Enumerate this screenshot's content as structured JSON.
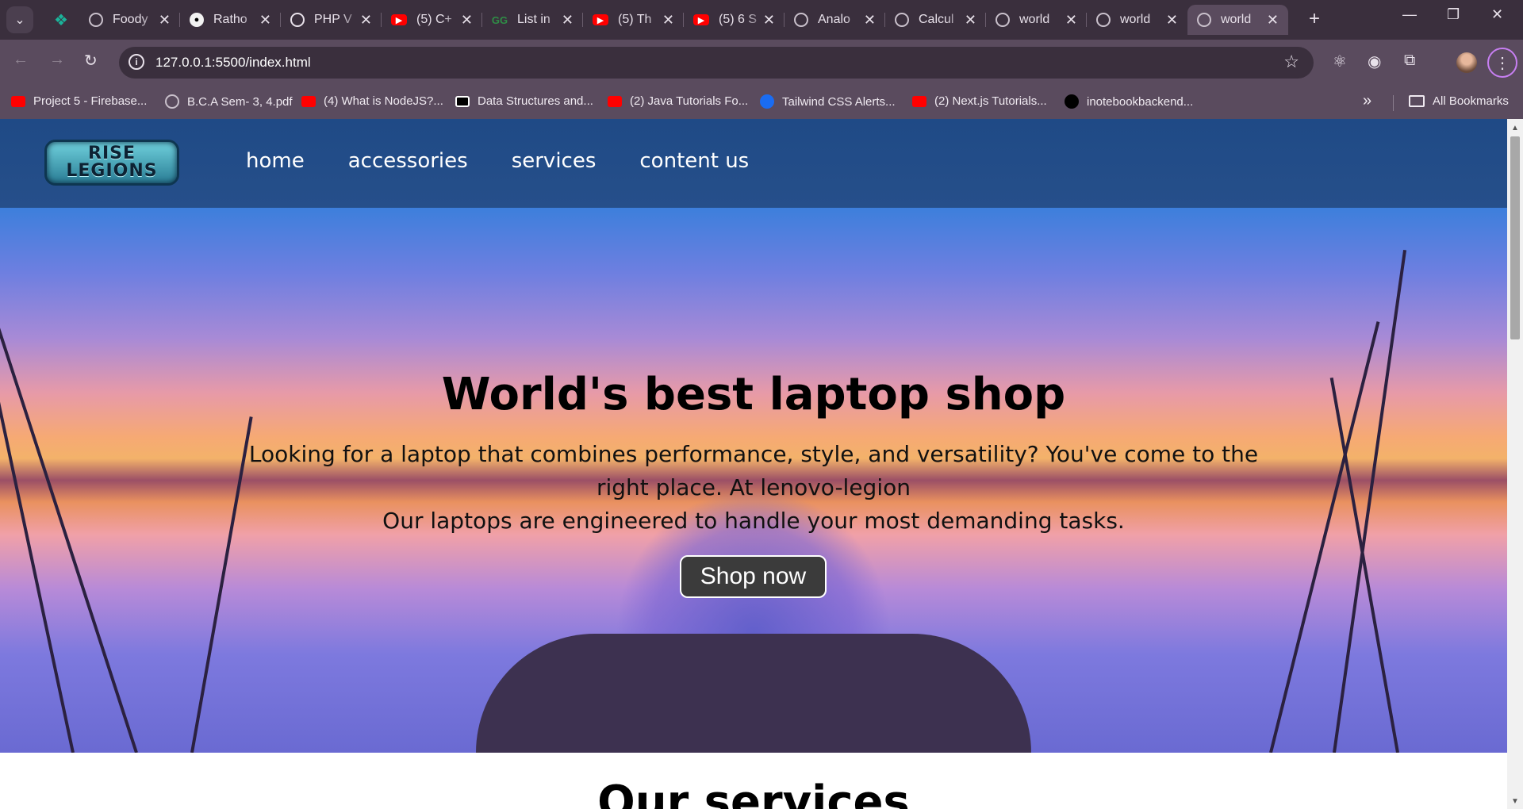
{
  "browser": {
    "tabs": [
      {
        "title": "",
        "icon": "foody-icon"
      },
      {
        "title": "Foody",
        "icon": "globe-icon"
      },
      {
        "title": "Ratho",
        "icon": "github-icon"
      },
      {
        "title": "PHP V",
        "icon": "chatgpt-icon"
      },
      {
        "title": "(5) C+",
        "icon": "youtube-icon"
      },
      {
        "title": "List in",
        "icon": "gfg-icon"
      },
      {
        "title": "(5) Th",
        "icon": "youtube-icon"
      },
      {
        "title": "(5) 6 S",
        "icon": "youtube-icon"
      },
      {
        "title": "Analo",
        "icon": "globe-icon"
      },
      {
        "title": "Calcul",
        "icon": "globe-icon"
      },
      {
        "title": "world",
        "icon": "globe-icon"
      },
      {
        "title": "world",
        "icon": "globe-icon"
      },
      {
        "title": "world",
        "icon": "globe-icon",
        "active": true
      }
    ],
    "url": "127.0.0.1:5500/index.html",
    "bookmarks": [
      {
        "label": "Project 5 - Firebase...",
        "icon": "youtube-icon"
      },
      {
        "label": "B.C.A Sem- 3, 4.pdf",
        "icon": "globe-icon"
      },
      {
        "label": "(4) What is NodeJS?...",
        "icon": "youtube-icon"
      },
      {
        "label": "Data Structures and...",
        "icon": "dsa-icon"
      },
      {
        "label": "(2) Java Tutorials Fo...",
        "icon": "youtube-icon"
      },
      {
        "label": "Tailwind CSS Alerts...",
        "icon": "tailwind-icon"
      },
      {
        "label": "(2) Next.js Tutorials...",
        "icon": "youtube-icon"
      },
      {
        "label": "inotebookbackend...",
        "icon": "triangle-icon"
      }
    ],
    "all_bookmarks": "All Bookmarks"
  },
  "site": {
    "logo_line1": "RISE",
    "logo_line2": "LEGIONS",
    "nav": [
      "home",
      "accessories",
      "services",
      "content us"
    ],
    "hero_title": "World's best laptop shop",
    "hero_text_1": "Looking for a laptop that combines performance, style, and versatility? You've come to the right place. At lenovo-legion",
    "hero_text_2": "Our laptops are engineered to handle your most demanding tasks.",
    "cta": "Shop now",
    "section_title": "Our services"
  }
}
